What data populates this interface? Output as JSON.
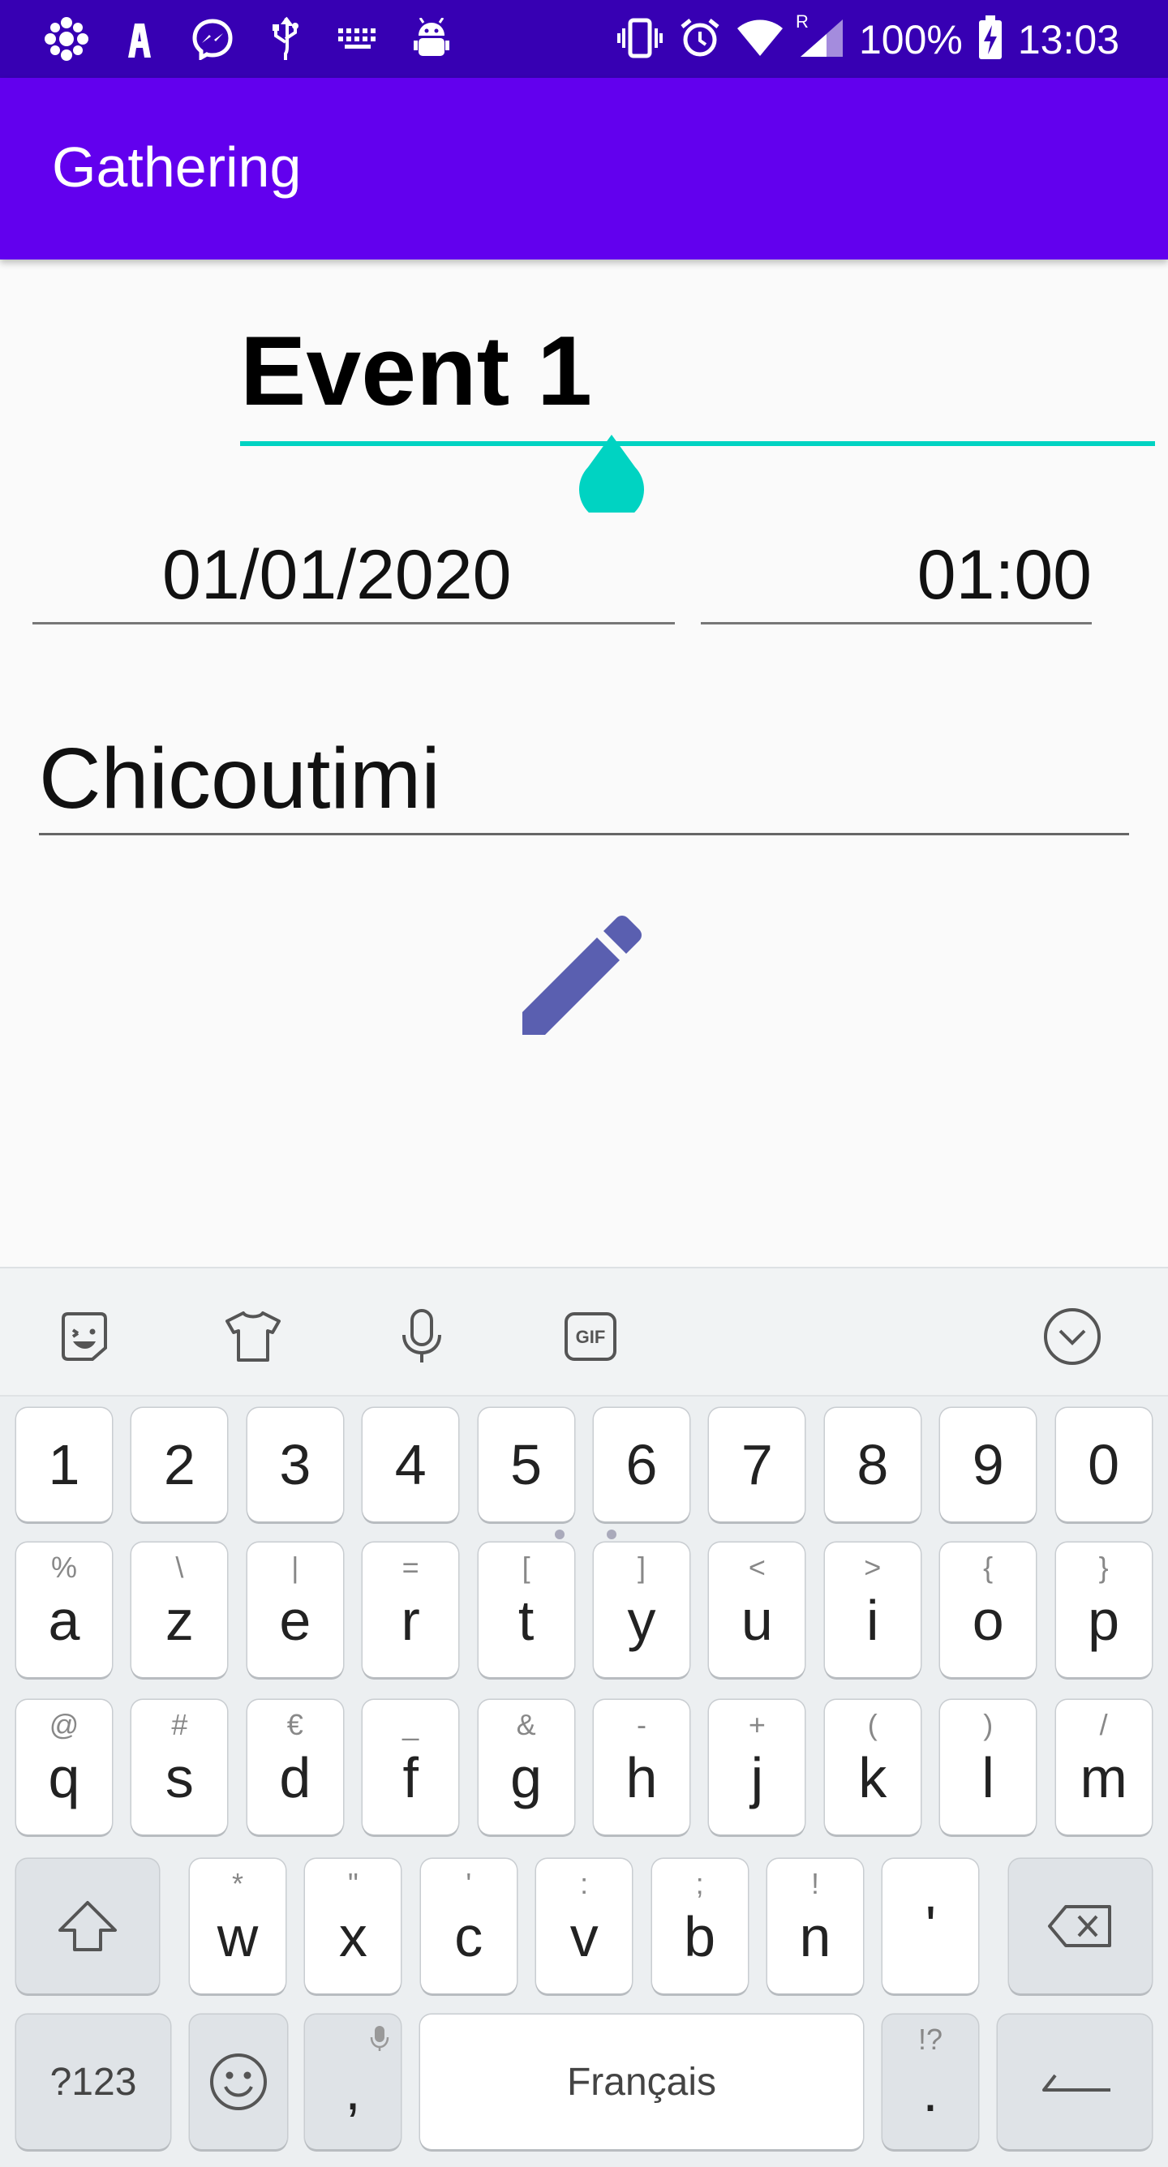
{
  "status_bar": {
    "left_icons": [
      "cbc-radio-icon",
      "accessibility-icon",
      "messenger-icon",
      "usb-icon",
      "keyboard-icon",
      "android-debug-icon"
    ],
    "right_icons": [
      "vibrate-icon",
      "alarm-icon",
      "wifi-icon",
      "signal-icon"
    ],
    "roaming": "R",
    "battery": "100%",
    "time": "13:03"
  },
  "app_bar": {
    "title": "Gathering"
  },
  "form": {
    "event_name": "Event 1",
    "date": "01/01/2020",
    "time": "01:00",
    "location": "Chicoutimi"
  },
  "colors": {
    "status_bar": "#3700b3",
    "app_bar": "#6200ee",
    "accent": "#00d3c2",
    "edit_icon": "#5a5fb0"
  },
  "keyboard": {
    "toolbar": [
      "sticker-icon",
      "theme-icon",
      "microphone-icon",
      "gif-icon",
      "collapse-icon"
    ],
    "row_numbers": [
      "1",
      "2",
      "3",
      "4",
      "5",
      "6",
      "7",
      "8",
      "9",
      "0"
    ],
    "row1": [
      {
        "main": "a",
        "sub": "%"
      },
      {
        "main": "z",
        "sub": "\\"
      },
      {
        "main": "e",
        "sub": "|"
      },
      {
        "main": "r",
        "sub": "="
      },
      {
        "main": "t",
        "sub": "["
      },
      {
        "main": "y",
        "sub": "]"
      },
      {
        "main": "u",
        "sub": "<"
      },
      {
        "main": "i",
        "sub": ">"
      },
      {
        "main": "o",
        "sub": "{"
      },
      {
        "main": "p",
        "sub": "}"
      }
    ],
    "row2": [
      {
        "main": "q",
        "sub": "@"
      },
      {
        "main": "s",
        "sub": "#"
      },
      {
        "main": "d",
        "sub": "€"
      },
      {
        "main": "f",
        "sub": "_"
      },
      {
        "main": "g",
        "sub": "&"
      },
      {
        "main": "h",
        "sub": "-"
      },
      {
        "main": "j",
        "sub": "+"
      },
      {
        "main": "k",
        "sub": "("
      },
      {
        "main": "l",
        "sub": ")"
      },
      {
        "main": "m",
        "sub": "/"
      }
    ],
    "row3": [
      {
        "main": "w",
        "sub": "*"
      },
      {
        "main": "x",
        "sub": "\""
      },
      {
        "main": "c",
        "sub": "'"
      },
      {
        "main": "v",
        "sub": ":"
      },
      {
        "main": "b",
        "sub": ";"
      },
      {
        "main": "n",
        "sub": "!"
      },
      {
        "main": "'",
        "sub": ""
      }
    ],
    "symbols_label": "?123",
    "comma": ",",
    "space_label": "Français",
    "period": ".",
    "period_sub": "!?"
  }
}
